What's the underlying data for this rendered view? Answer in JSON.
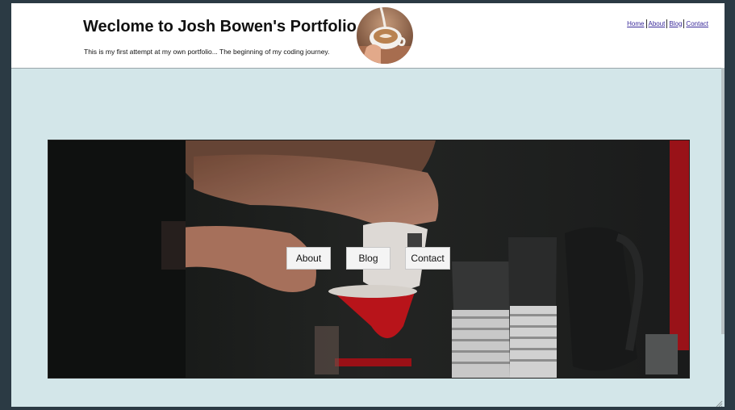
{
  "header": {
    "title": "Weclome to Josh Bowen's Portfolio.",
    "tagline": "This is my first attempt at my own portfolio... The beginning of my coding journey."
  },
  "top_nav": {
    "items": [
      {
        "label": "Home"
      },
      {
        "label": "About"
      },
      {
        "label": "Blog"
      },
      {
        "label": "Contact"
      }
    ]
  },
  "hero": {
    "buttons": [
      {
        "label": "About"
      },
      {
        "label": "Blog"
      },
      {
        "label": "Contact"
      }
    ]
  },
  "colors": {
    "page_background": "#d3e6e9",
    "header_background": "#ffffff",
    "link": "#3a2a9a",
    "dripper_red": "#c8161d"
  },
  "icons": [
    "latte-avatar-image",
    "resize-grip-icon"
  ]
}
